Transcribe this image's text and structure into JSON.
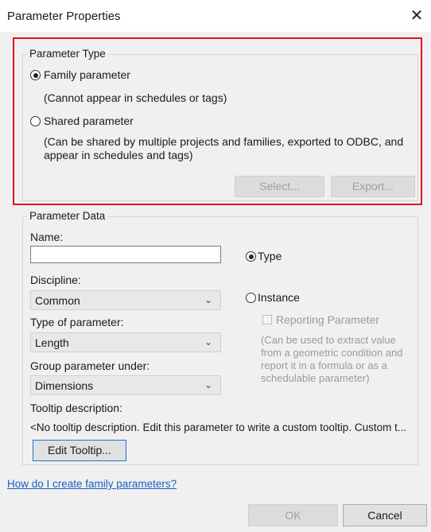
{
  "window": {
    "title": "Parameter Properties",
    "close_glyph": "✕"
  },
  "parameter_type": {
    "legend": "Parameter Type",
    "family_label": "Family parameter",
    "family_note": "(Cannot appear in schedules or tags)",
    "shared_label": "Shared parameter",
    "shared_note_line1": "(Can be shared by multiple projects and families, exported to ODBC, and",
    "shared_note_line2": "appear in schedules and tags)",
    "selected": "family",
    "select_button": "Select...",
    "export_button": "Export..."
  },
  "parameter_data": {
    "legend": "Parameter Data",
    "name_label": "Name:",
    "name_value": "",
    "discipline_label": "Discipline:",
    "discipline_value": "Common",
    "type_of_parameter_label": "Type of parameter:",
    "type_of_parameter_value": "Length",
    "group_label": "Group parameter under:",
    "group_value": "Dimensions",
    "type_radio_label": "Type",
    "instance_radio_label": "Instance",
    "selected_scope": "type",
    "reporting_label": "Reporting Parameter",
    "reporting_note": [
      "(Can be used to extract value",
      "from a geometric condition and",
      "report it in a formula or as a",
      "schedulable parameter)"
    ],
    "tooltip_label": "Tooltip description:",
    "tooltip_text": "<No tooltip description. Edit this parameter to write a custom tooltip. Custom t...",
    "edit_tooltip_button": "Edit Tooltip..."
  },
  "help_link": "How do I create family parameters?",
  "footer": {
    "ok": "OK",
    "cancel": "Cancel"
  },
  "colors": {
    "highlight_border": "#e0161c",
    "link": "#1a5fc2",
    "focus_border": "#1b74d1"
  }
}
